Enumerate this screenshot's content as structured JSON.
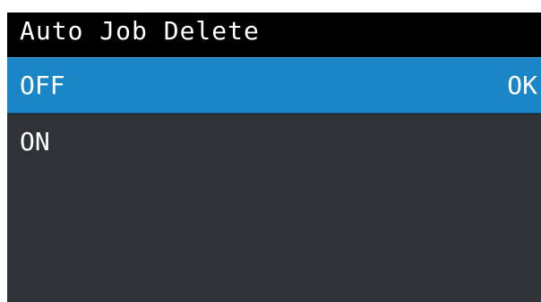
{
  "header": {
    "title": "Auto Job Delete"
  },
  "menu": {
    "items": [
      {
        "label": "OFF",
        "status": "OK",
        "selected": true
      },
      {
        "label": "ON",
        "status": "",
        "selected": false
      }
    ]
  },
  "colors": {
    "title_bar_bg": "#000000",
    "screen_bg": "#2f3236",
    "selected_bg": "#1a86c8",
    "text": "#ffffff"
  }
}
